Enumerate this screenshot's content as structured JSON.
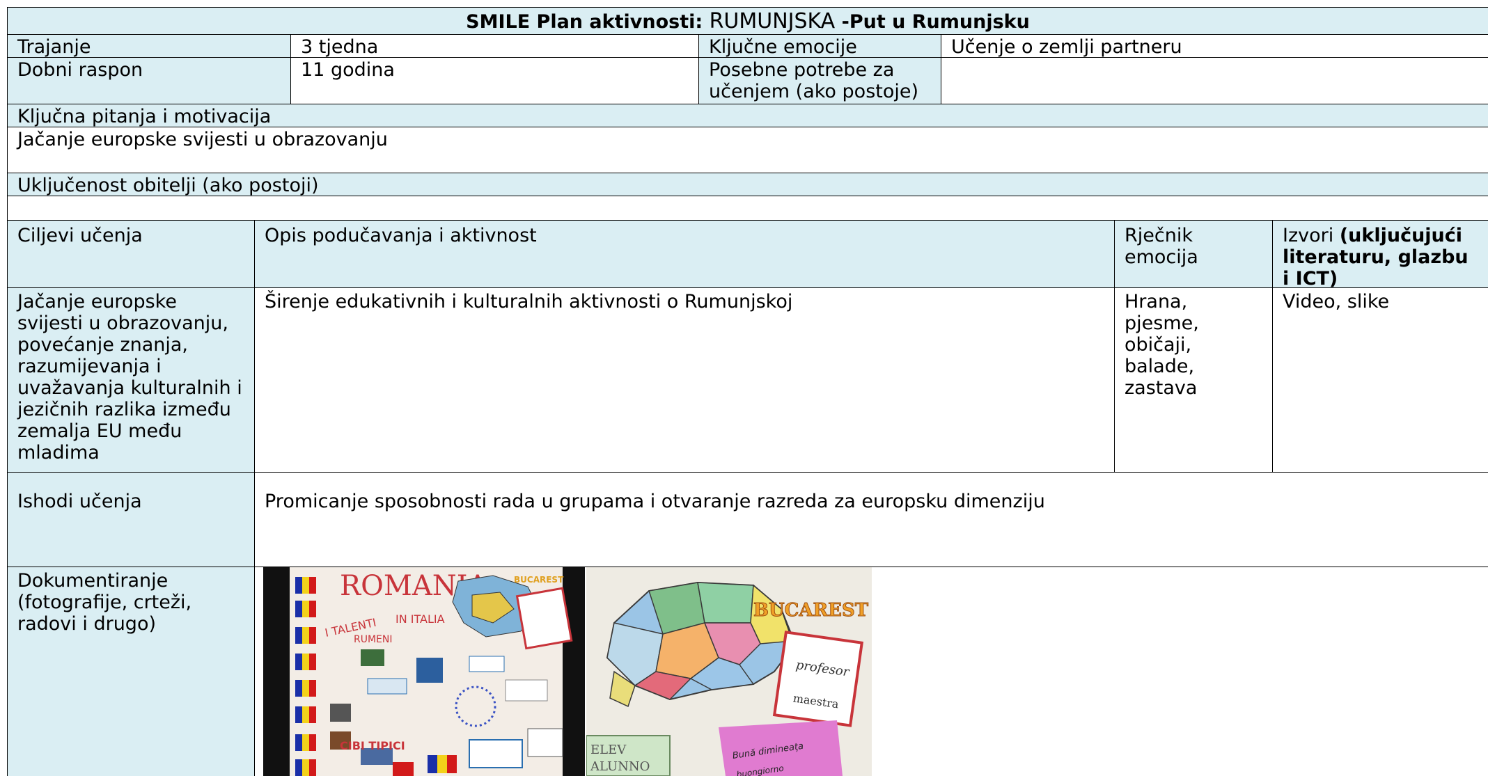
{
  "header": {
    "title_prefix": "SMILE Plan aktivnosti:",
    "title_country": "RUMUNJSKA",
    "title_suffix": "-Put u Rumunjsku"
  },
  "info": {
    "trajanje_label": "Trajanje",
    "trajanje_value": "3 tjedna",
    "kljucne_emocije_label": "Ključne emocije",
    "kljucne_emocije_value": "Učenje o zemlji partneru",
    "dobni_raspon_label": "Dobni raspon",
    "dobni_raspon_value": "11 godina",
    "posebne_potrebe_label": "Posebne potrebe za učenjem (ako postoje)",
    "posebne_potrebe_value": ""
  },
  "sections": {
    "kljucna_pitanja_label": "Ključna pitanja i motivacija",
    "kljucna_pitanja_value": "Jačanje europske svijesti u obrazovanju",
    "obitelj_label": "Uključenost obitelji (ako postoji)",
    "obitelj_value": ""
  },
  "activity_table": {
    "headers": {
      "ciljevi": "Ciljevi učenja",
      "opis": "Opis podučavanja i aktivnost",
      "rjecnik": "Rječnik emocija",
      "izvori_plain": "Izvori ",
      "izvori_bold": "(uključujući literaturu, glazbu i ICT)"
    },
    "row": {
      "ciljevi": "Jačanje europske svijesti u obrazovanju, povećanje znanja, razumijevanja i uvažavanja kulturalnih i jezičnih razlika između zemalja EU među mladima",
      "opis": "Širenje edukativnih i kulturalnih aktivnosti o Rumunjskoj",
      "rjecnik": "Hrana, pjesme, običaji, balade, zastava",
      "izvori": "Video, slike"
    }
  },
  "ishodi": {
    "label": "Ishodi učenja",
    "value": "Promicanje sposobnosti rada u grupama i otvaranje razreda za europsku dimenziju"
  },
  "dokumentiranje": {
    "label": "Dokumentiranje (fotografije, crteži, radovi i drugo)",
    "photo1": {
      "title": "ROMANIA",
      "sub1": "I TALENTI",
      "sub2": "IN ITALIA",
      "sub3": "RUMENI",
      "cibi": "CIBI TIPICI",
      "tag": "BUCAREST"
    },
    "photo2": {
      "city": "BUCAREST",
      "word1": "profesor",
      "word2": "maestra",
      "word3": "Bună dimineața",
      "word4": "buongiorno",
      "word5": "ELEV",
      "word6": "ALUNNO"
    }
  },
  "colors": {
    "header_bg": "#daeef3",
    "border": "#000000"
  }
}
